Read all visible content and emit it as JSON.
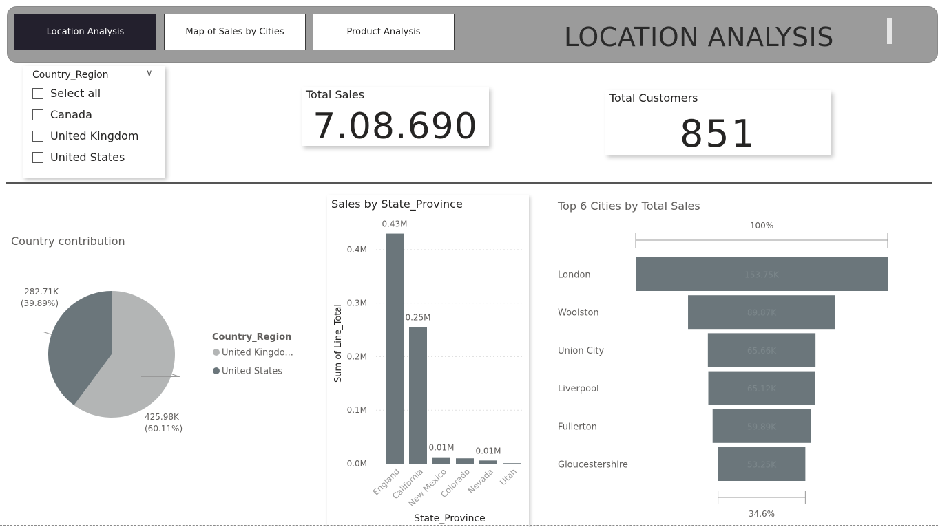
{
  "header": {
    "tabs": [
      {
        "label": "Location Analysis",
        "active": true
      },
      {
        "label": "Map of Sales by Cities",
        "active": false
      },
      {
        "label": "Product Analysis",
        "active": false
      }
    ],
    "title": "LOCATION ANALYSIS"
  },
  "slicer": {
    "title": "Country_Region",
    "items": [
      "Select all",
      "Canada",
      "United Kingdom",
      "United States"
    ]
  },
  "cards": {
    "total_sales": {
      "title": "Total Sales",
      "value": "7.08.690"
    },
    "total_customers": {
      "title": "Total Customers",
      "value": "851"
    }
  },
  "colors": {
    "dark": "#6b767b",
    "light": "#b3b5b5",
    "header": "#9b9b9b",
    "active_tab": "#23202d"
  },
  "chart_data": [
    {
      "type": "pie",
      "title": "Country contribution",
      "legend_title": "Country_Region",
      "legend_position": "right",
      "slices": [
        {
          "label": "United Kingdo...",
          "value": 425.98,
          "value_label": "425.98K",
          "pct_label": "(60.11%)",
          "color": "#b3b5b5"
        },
        {
          "label": "United States",
          "value": 282.71,
          "value_label": "282.71K",
          "pct_label": "(39.89%)",
          "color": "#6b767b"
        }
      ]
    },
    {
      "type": "bar",
      "title": "Sales by State_Province",
      "xlabel": "State_Province",
      "ylabel": "Sum of Line_Total",
      "categories": [
        "England",
        "California",
        "New Mexico",
        "Colorado",
        "Nevada",
        "Utah"
      ],
      "values": [
        0.43,
        0.255,
        0.012,
        0.01,
        0.006,
        0.001
      ],
      "data_labels": [
        "0.43M",
        "0.25M",
        "0.01M",
        "",
        "0.01M",
        ""
      ],
      "ylim": [
        0,
        0.45
      ],
      "yticks": [
        "0.0M",
        "0.1M",
        "0.2M",
        "0.3M",
        "0.4M"
      ],
      "grid": true
    },
    {
      "type": "bar",
      "subtype": "funnel",
      "title": "Top 6 Cities by Total Sales",
      "categories": [
        "London",
        "Woolston",
        "Union City",
        "Liverpool",
        "Fullerton",
        "Gloucestershire"
      ],
      "values": [
        153.75,
        89.87,
        65.66,
        65.12,
        59.89,
        53.25
      ],
      "data_labels": [
        "153.75K",
        "89.87K",
        "65.66K",
        "65.12K",
        "59.89K",
        "53.25K"
      ],
      "top_label": "100%",
      "bottom_label": "34.6%"
    }
  ]
}
